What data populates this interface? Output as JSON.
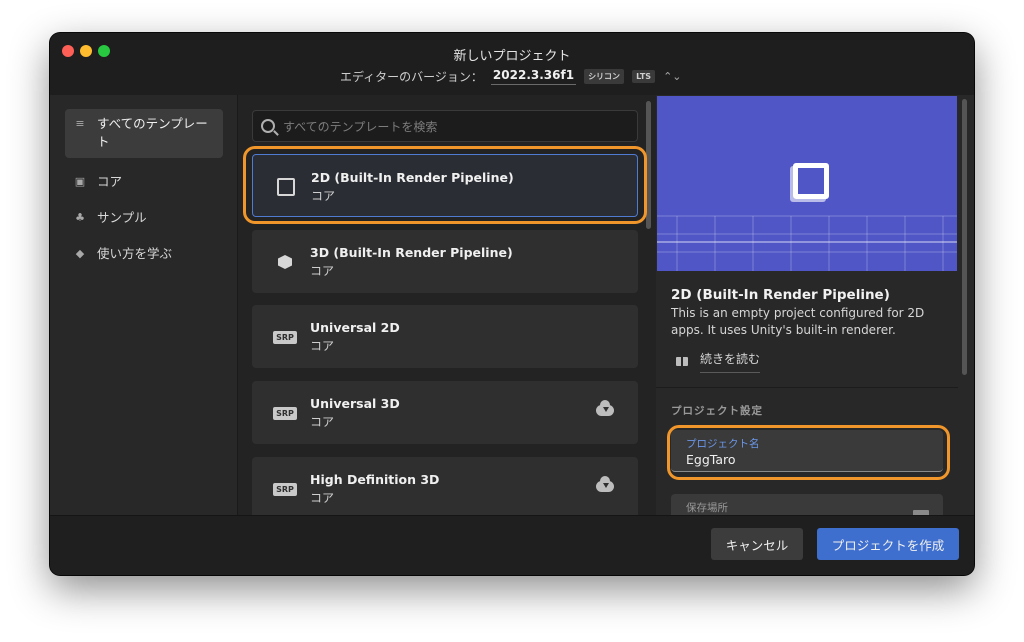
{
  "window": {
    "title": "新しいプロジェクト",
    "version_label": "エディターのバージョン：",
    "version_value": "2022.3.36f1",
    "arch_badge": "シリコン",
    "lts_badge": "LTS"
  },
  "sidebar": {
    "items": [
      {
        "label": "すべてのテンプレート",
        "icon": "list-icon"
      },
      {
        "label": "コア",
        "icon": "core-icon"
      },
      {
        "label": "サンプル",
        "icon": "sample-icon"
      },
      {
        "label": "使い方を学ぶ",
        "icon": "learn-icon"
      }
    ]
  },
  "search": {
    "placeholder": "すべてのテンプレートを検索"
  },
  "templates": [
    {
      "title": "2D (Built-In Render Pipeline)",
      "category": "コア",
      "icon": "square-icon",
      "selected": true
    },
    {
      "title": "3D (Built-In Render Pipeline)",
      "category": "コア",
      "icon": "cube-icon"
    },
    {
      "title": "Universal 2D",
      "category": "コア",
      "icon": "SRP"
    },
    {
      "title": "Universal 3D",
      "category": "コア",
      "icon": "SRP",
      "download": true
    },
    {
      "title": "High Definition 3D",
      "category": "コア",
      "icon": "SRP",
      "download": true
    }
  ],
  "details": {
    "title": "2D (Built-In Render Pipeline)",
    "description": "This is an empty project configured for 2D apps. It uses Unity's built-in renderer.",
    "read_more": "続きを読む",
    "settings_label": "プロジェクト設定",
    "project_name_label": "プロジェクト名",
    "project_name_value": "EggTaro",
    "location_label": "保存場所"
  },
  "footer": {
    "cancel": "キャンセル",
    "create": "プロジェクトを作成"
  },
  "colors": {
    "accent": "#3e6fcf",
    "highlight": "#f0962a",
    "preview_bg": "#5156c7"
  }
}
